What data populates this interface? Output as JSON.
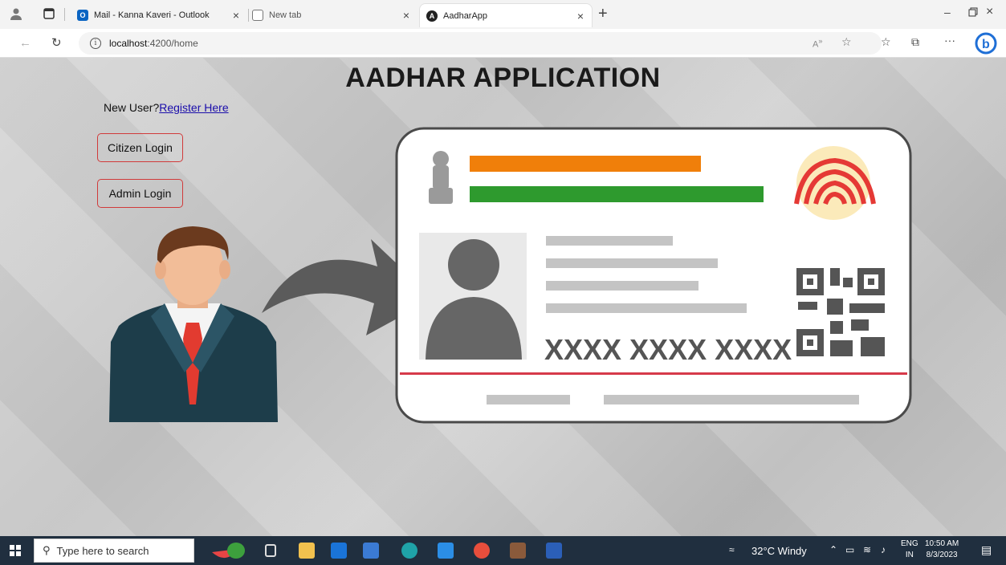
{
  "browser": {
    "tabs": [
      {
        "label": "Mail - Kanna Kaveri - Outlook",
        "icon": "outlook-icon"
      },
      {
        "label": "New tab",
        "icon": "newtab-icon"
      },
      {
        "label": "AadharApp",
        "icon": "angular-icon"
      }
    ],
    "url_host": "localhost",
    "url_rest": ":4200/home"
  },
  "page": {
    "title": "AADHAR APPLICATION",
    "new_user_text": "New User?",
    "register_link": "Register Here",
    "citizen_login": "Citizen Login",
    "admin_login": "Admin Login",
    "card_number": "XXXX XXXX XXXX"
  },
  "taskbar": {
    "search_placeholder": "Type here to search",
    "weather": "32°C Windy",
    "lang_top": "ENG",
    "lang_bottom": "IN",
    "time": "10:50 AM",
    "date": "8/3/2023"
  },
  "colors": {
    "accent_border": "#d13a3a",
    "link": "#1a0dab",
    "tricolor_orange": "#f07f0a",
    "tricolor_green": "#2e9a2e",
    "taskbar": "#202f3f"
  }
}
